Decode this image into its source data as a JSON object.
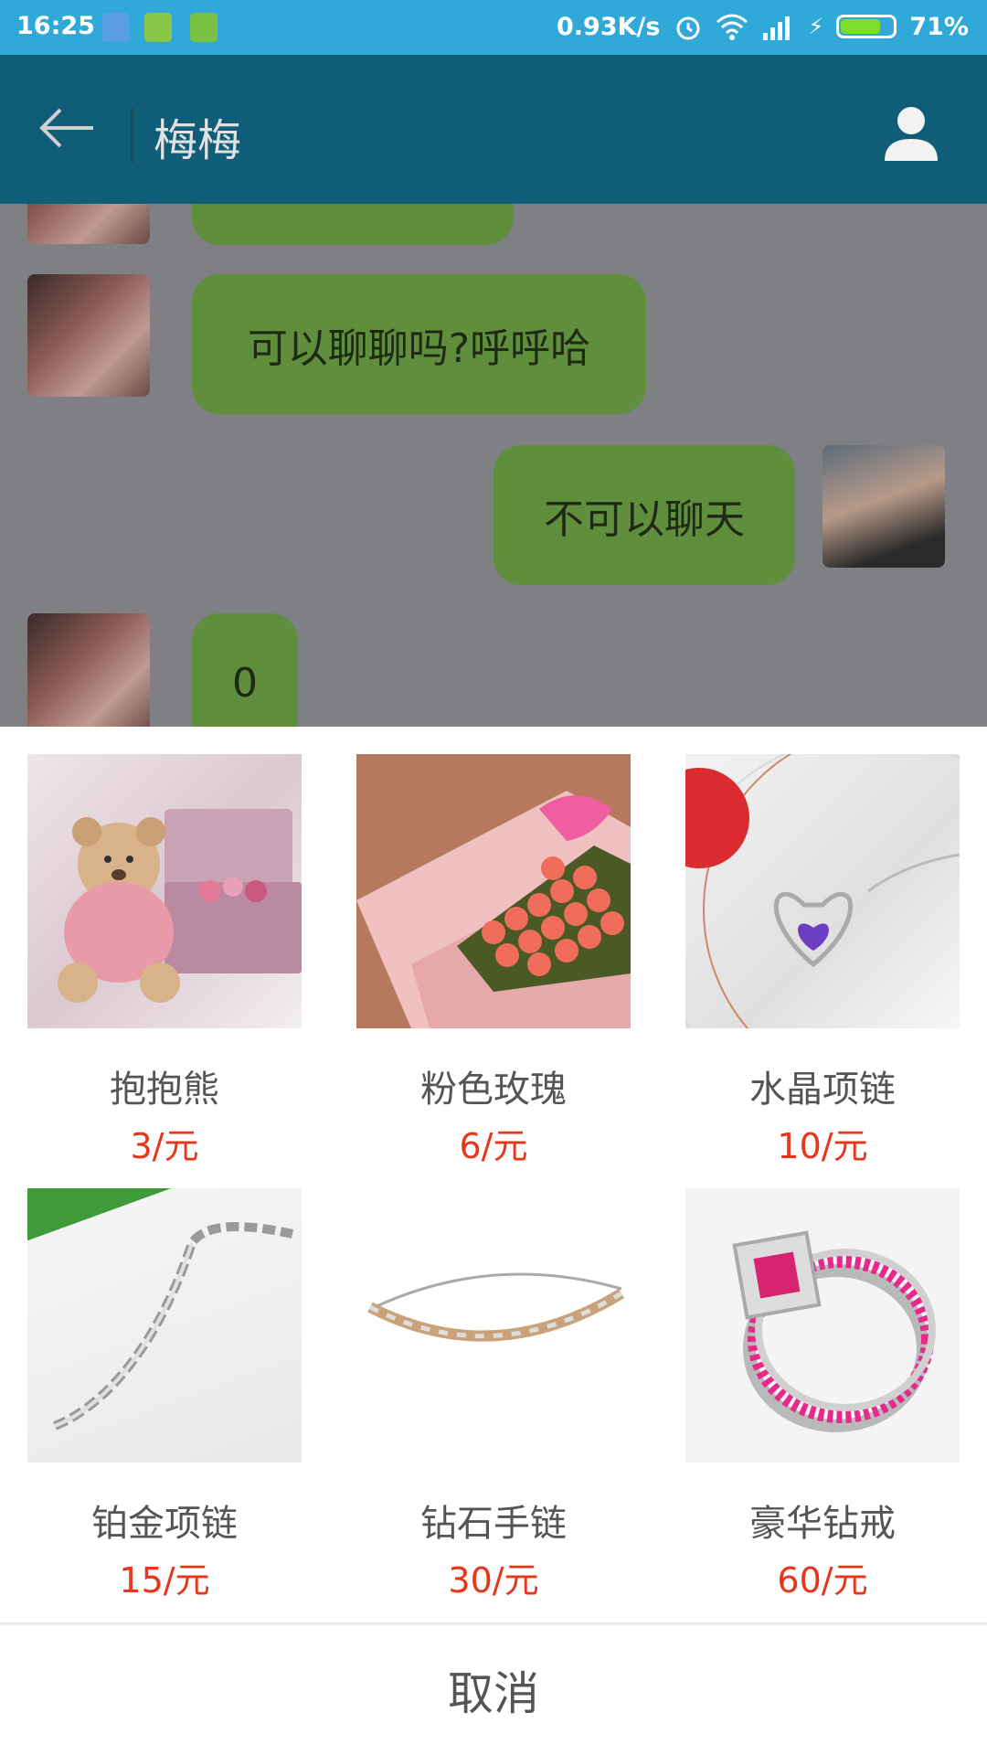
{
  "status_bar": {
    "time": "16:25",
    "network_speed": "0.93K/s",
    "battery_percent": "71%",
    "battery_level": 0.71
  },
  "header": {
    "title": "梅梅"
  },
  "chat": {
    "messages": [
      {
        "side": "left",
        "text": "可以聊聊吗?呼呼哈"
      },
      {
        "side": "right",
        "text": "不可以聊天"
      },
      {
        "side": "left",
        "text": "0"
      }
    ]
  },
  "gifts": [
    {
      "name": "抱抱熊",
      "price": "3/元",
      "icon": "teddy-bear"
    },
    {
      "name": "粉色玫瑰",
      "price": "6/元",
      "icon": "pink-roses"
    },
    {
      "name": "水晶项链",
      "price": "10/元",
      "icon": "crystal-necklace"
    },
    {
      "name": "铂金项链",
      "price": "15/元",
      "icon": "platinum-necklace"
    },
    {
      "name": "钻石手链",
      "price": "30/元",
      "icon": "diamond-bracelet"
    },
    {
      "name": "豪华钻戒",
      "price": "60/元",
      "icon": "diamond-ring"
    }
  ],
  "cancel_label": "取消",
  "colors": {
    "status_bar": "#30a8d8",
    "app_bar": "#0f5d77",
    "bubble": "#5f8f3c",
    "price": "#e8361b"
  }
}
